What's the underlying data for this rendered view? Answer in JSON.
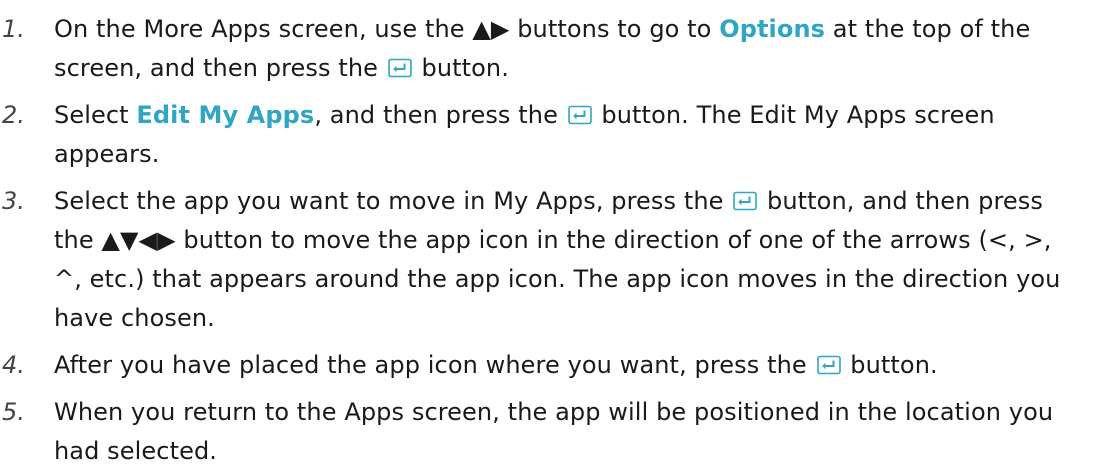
{
  "steps": [
    {
      "number": "1.",
      "parts": [
        {
          "type": "text",
          "value": "On the More Apps screen, use the ▲▶ buttons to go to "
        },
        {
          "type": "highlight",
          "value": "Options"
        },
        {
          "type": "text",
          "value": " at the top of the screen, and then press the "
        },
        {
          "type": "icon",
          "name": "enter-icon"
        },
        {
          "type": "text",
          "value": " button."
        }
      ]
    },
    {
      "number": "2.",
      "parts": [
        {
          "type": "text",
          "value": "Select "
        },
        {
          "type": "highlight",
          "value": "Edit My Apps"
        },
        {
          "type": "text",
          "value": ", and then press the "
        },
        {
          "type": "icon",
          "name": "enter-icon"
        },
        {
          "type": "text",
          "value": " button. The Edit My Apps screen appears."
        }
      ]
    },
    {
      "number": "3.",
      "parts": [
        {
          "type": "text",
          "value": "Select the app you want to move in My Apps, press the "
        },
        {
          "type": "icon",
          "name": "enter-icon"
        },
        {
          "type": "text",
          "value": " button, and then press the ▲▼◀▶ button to move the app icon in the direction of one of the arrows (<, >, ^, etc.) that appears around the app icon. The app icon moves in the direction you have chosen."
        }
      ]
    },
    {
      "number": "4.",
      "parts": [
        {
          "type": "text",
          "value": "After you have placed the app icon where you want, press the "
        },
        {
          "type": "icon",
          "name": "enter-icon"
        },
        {
          "type": "text",
          "value": " button."
        }
      ]
    },
    {
      "number": "5.",
      "parts": [
        {
          "type": "text",
          "value": "When you return to the Apps screen, the app will be positioned in the location you had selected."
        }
      ]
    }
  ],
  "colors": {
    "highlight": "#2ea6c4",
    "text": "#1a1a1a",
    "icon_border": "#2ea6c4"
  }
}
